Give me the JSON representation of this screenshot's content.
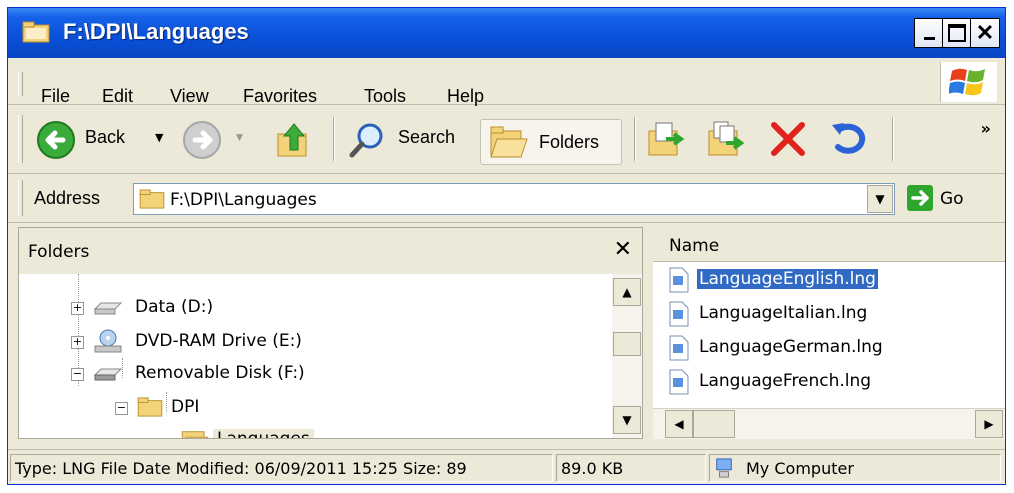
{
  "window": {
    "title": "F:\\DPI\\Languages"
  },
  "menu": [
    "File",
    "Edit",
    "View",
    "Favorites",
    "Tools",
    "Help"
  ],
  "toolbar": {
    "back_label": "Back",
    "search_label": "Search",
    "folders_label": "Folders",
    "more_label": "»"
  },
  "address": {
    "label": "Address",
    "value": "F:\\DPI\\Languages",
    "go_label": "Go"
  },
  "folders_pane": {
    "title": "Folders",
    "tree": [
      {
        "label": "Data (D:)",
        "expander": "+",
        "icon": "drive-icon"
      },
      {
        "label": "DVD-RAM Drive (E:)",
        "expander": "+",
        "icon": "dvd-drive-icon"
      },
      {
        "label": "Removable Disk (F:)",
        "expander": "−",
        "icon": "removable-disk-icon"
      },
      {
        "label": "DPI",
        "expander": "−",
        "icon": "folder-icon"
      },
      {
        "label": "Languages",
        "expander": "",
        "icon": "open-folder-icon"
      }
    ]
  },
  "file_pane": {
    "column_name": "Name",
    "files": [
      {
        "name": "LanguageEnglish.lng",
        "selected": true
      },
      {
        "name": "LanguageItalian.lng",
        "selected": false
      },
      {
        "name": "LanguageGerman.lng",
        "selected": false
      },
      {
        "name": "LanguageFrench.lng",
        "selected": false
      }
    ]
  },
  "status": {
    "info": "Type: LNG File Date Modified: 06/09/2011 15:25 Size: 89",
    "size": "89.0 KB",
    "zone": "My Computer"
  },
  "colors": {
    "titlebar": "#0a50d8",
    "selection": "#316ac5",
    "chrome": "#ece9d8"
  }
}
